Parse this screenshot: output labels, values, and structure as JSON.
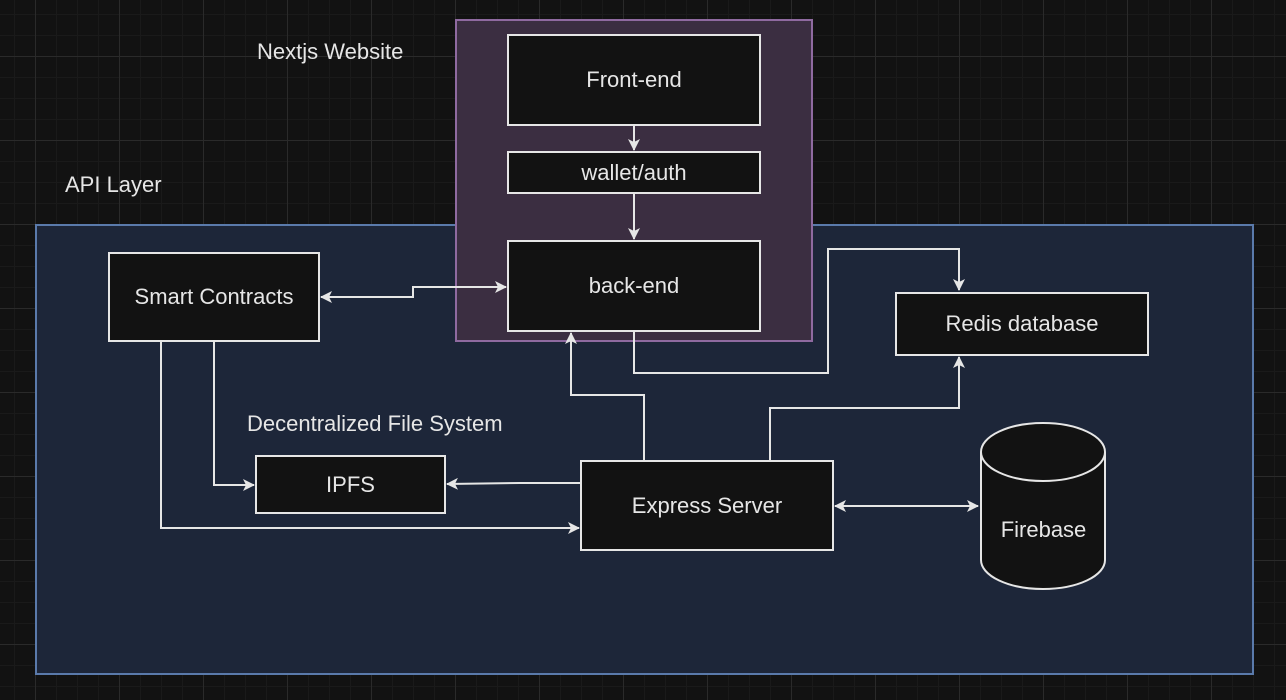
{
  "diagram": {
    "containers": {
      "api_layer": {
        "label": "API Layer",
        "fill": "#1d2639",
        "stroke": "#5a7aab"
      },
      "nextjs_site": {
        "label": "Nextjs Website",
        "fill": "#3b2e41",
        "stroke": "#8f6aa0"
      }
    },
    "labels": {
      "decentralized_fs": "Decentralized File System"
    },
    "nodes": {
      "frontend": "Front-end",
      "wallet_auth": "wallet/auth",
      "backend": "back-end",
      "smart_contracts": "Smart Contracts",
      "redis": "Redis database",
      "ipfs": "IPFS",
      "express": "Express Server",
      "firebase": "Firebase"
    },
    "edges": [
      {
        "from": "Front-end",
        "to": "wallet/auth",
        "direction": "forward"
      },
      {
        "from": "wallet/auth",
        "to": "back-end",
        "direction": "forward"
      },
      {
        "from": "Smart Contracts",
        "to": "back-end",
        "direction": "both"
      },
      {
        "from": "back-end",
        "to": "Redis database",
        "direction": "forward"
      },
      {
        "from": "Express Server",
        "to": "back-end",
        "direction": "forward"
      },
      {
        "from": "Express Server",
        "to": "Redis database",
        "direction": "forward"
      },
      {
        "from": "Smart Contracts",
        "to": "IPFS",
        "direction": "forward"
      },
      {
        "from": "Smart Contracts",
        "to": "Express Server",
        "direction": "forward"
      },
      {
        "from": "Express Server",
        "to": "IPFS",
        "direction": "forward"
      },
      {
        "from": "Express Server",
        "to": "Firebase",
        "direction": "both"
      }
    ],
    "colors": {
      "background": "#121212",
      "node_fill": "#121212",
      "node_stroke": "#e6e6e6",
      "text": "#e6e6e6"
    }
  }
}
